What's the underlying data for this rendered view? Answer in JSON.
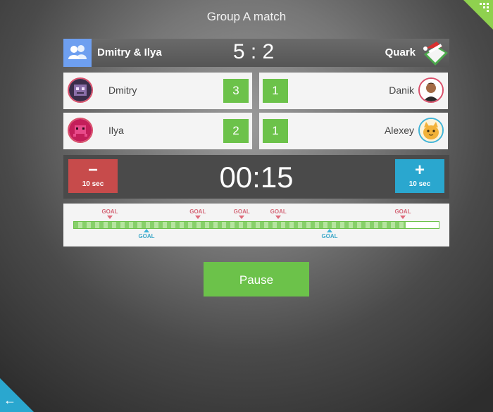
{
  "title": "Group A match",
  "home_team": {
    "name": "Dmitry & Ilya",
    "icon": "group-icon",
    "color": "#6e9ff0"
  },
  "away_team": {
    "name": "Quark",
    "icon": "team-logo-icon"
  },
  "score": "5 : 2",
  "players": {
    "home": [
      {
        "name": "Dmitry",
        "goals": "3",
        "avatar": "robot-avatar-icon"
      },
      {
        "name": "Ilya",
        "goals": "2",
        "avatar": "space-invader-avatar-icon"
      }
    ],
    "away": [
      {
        "name": "Danik",
        "goals": "1",
        "avatar": "person-avatar-icon"
      },
      {
        "name": "Alexey",
        "goals": "1",
        "avatar": "cat-avatar-icon"
      }
    ]
  },
  "timer": {
    "time": "00:15",
    "minus_symbol": "−",
    "minus_label": "10 sec",
    "plus_symbol": "+",
    "plus_label": "10 sec"
  },
  "timeline": {
    "goal_label": "GOAL",
    "progress": 0.91,
    "home_goals_at": [
      0.1,
      0.34,
      0.46,
      0.56,
      0.9
    ],
    "away_goals_at": [
      0.2,
      0.7
    ]
  },
  "pause_label": "Pause",
  "colors": {
    "green": "#6cc24a",
    "red": "#c74b4b",
    "blue": "#2aa7cf",
    "home_marker": "#e06a7a",
    "away_marker": "#41b4d8"
  }
}
